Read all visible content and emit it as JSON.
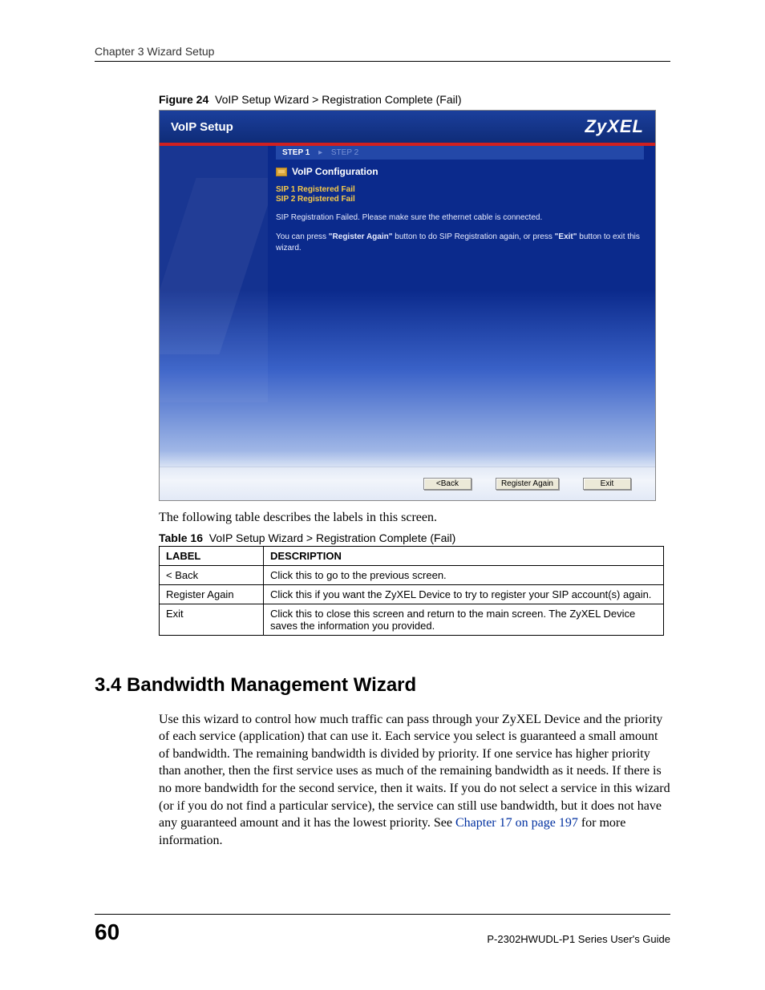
{
  "header": {
    "chapter": "Chapter 3 Wizard Setup"
  },
  "figure": {
    "label": "Figure 24",
    "caption": "VoIP Setup Wizard > Registration Complete (Fail)"
  },
  "wizard": {
    "title": "VoIP Setup",
    "brand": "ZyXEL",
    "steps": {
      "active": "STEP 1",
      "inactive": "STEP 2"
    },
    "section": "VoIP Configuration",
    "sip1": "SIP 1 Registered Fail",
    "sip2": "SIP 2 Registered Fail",
    "msg1": "SIP Registration Failed. Please make sure the ethernet cable is connected.",
    "msg2_pre": "You can press ",
    "msg2_b1": "\"Register Again\"",
    "msg2_mid": " button to do SIP Registration again, or press ",
    "msg2_b2": "\"Exit\"",
    "msg2_post": " button to exit this wizard.",
    "buttons": {
      "back": "<Back",
      "register_again": "Register Again",
      "exit": "Exit"
    }
  },
  "intro_para": "The following table describes the labels in this screen.",
  "table": {
    "label": "Table 16",
    "caption": "VoIP Setup Wizard > Registration Complete (Fail)",
    "headers": {
      "label": "LABEL",
      "desc": "DESCRIPTION"
    },
    "rows": [
      {
        "label": "< Back",
        "desc": "Click this to go to the previous screen."
      },
      {
        "label": "Register Again",
        "desc": "Click this if you want the ZyXEL Device to try to register your SIP account(s) again."
      },
      {
        "label": "Exit",
        "desc": "Click this to close this screen and return to the main screen. The ZyXEL Device saves the information you provided."
      }
    ]
  },
  "section34": {
    "heading": "3.4  Bandwidth Management Wizard",
    "body_pre": "Use this wizard to control how much traffic can pass through your ZyXEL Device and the priority of each service (application) that can use it. Each service you select is guaranteed a small amount of bandwidth. The remaining bandwidth is divided by priority. If one service has higher priority than another, then the first service uses as much of the remaining bandwidth as it needs. If there is no more bandwidth for the second service, then it waits. If you do not select a service in this wizard (or if you do not find a particular service), the service can still use bandwidth, but it does not have any guaranteed amount and it has the lowest priority. See ",
    "link": "Chapter 17 on page 197",
    "body_post": " for more information."
  },
  "footer": {
    "page": "60",
    "guide": "P-2302HWUDL-P1 Series User's Guide"
  }
}
